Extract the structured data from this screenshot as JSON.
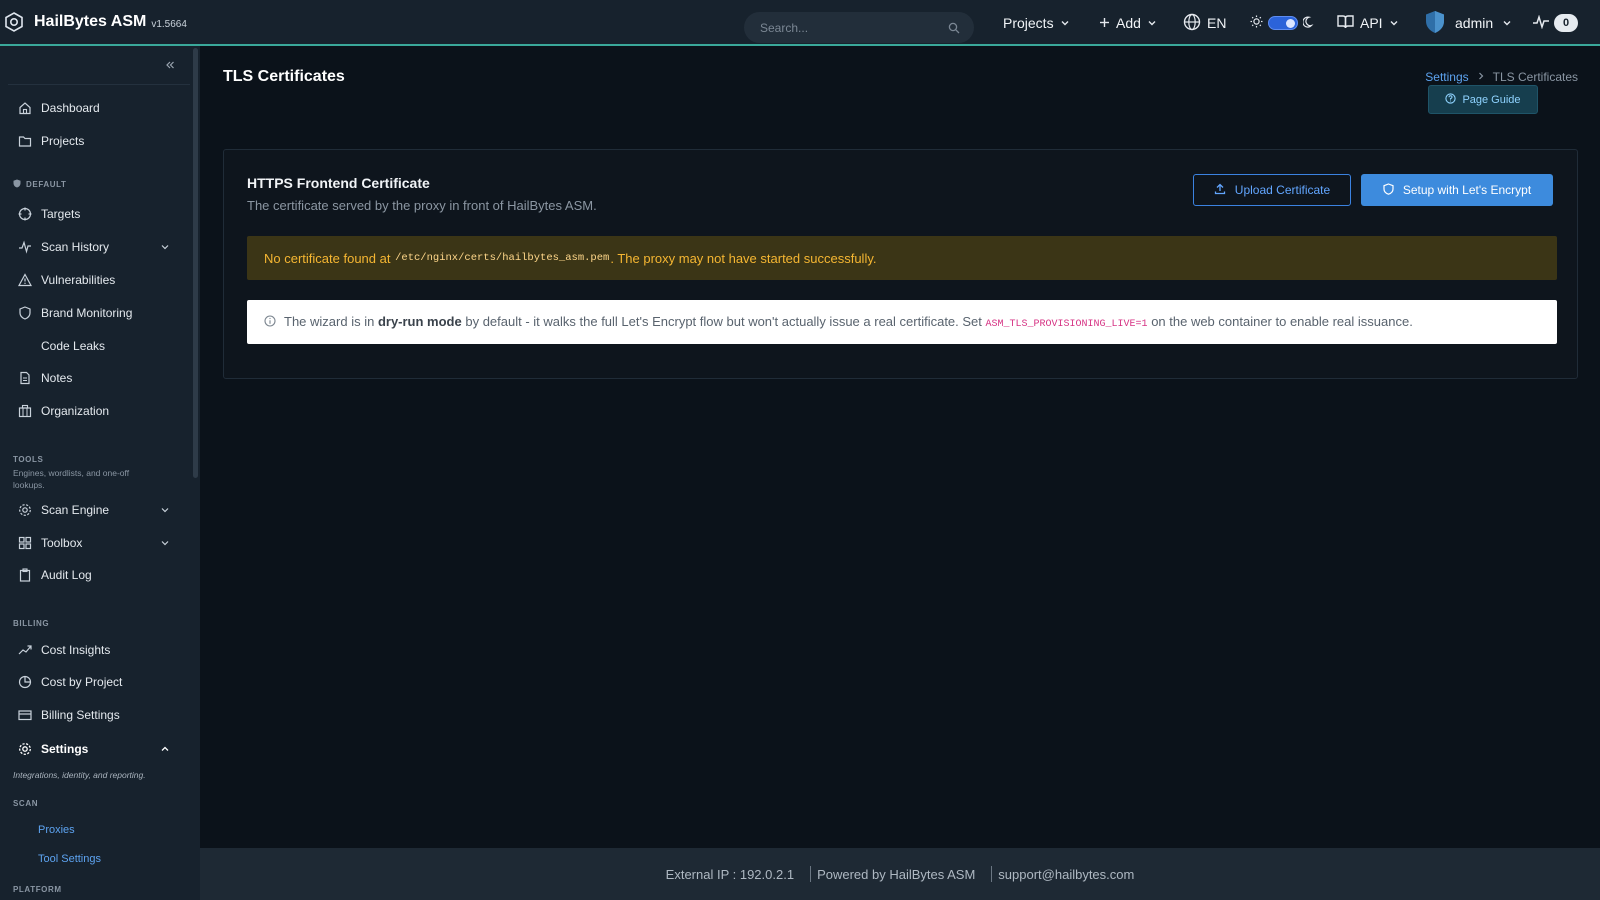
{
  "app": {
    "name": "HailBytes ASM",
    "version": "v1.5664"
  },
  "topbar": {
    "search_placeholder": "Search...",
    "projects_label": "Projects",
    "add_label": "Add",
    "language": "EN",
    "api_label": "API",
    "user": "admin",
    "activity_count": "0"
  },
  "sidebar": {
    "items": {
      "dashboard": "Dashboard",
      "projects": "Projects",
      "targets": "Targets",
      "scan_history": "Scan History",
      "vulnerabilities": "Vulnerabilities",
      "brand_monitoring": "Brand Monitoring",
      "code_leaks": "Code Leaks",
      "notes": "Notes",
      "organization": "Organization",
      "scan_engine": "Scan Engine",
      "toolbox": "Toolbox",
      "audit_log": "Audit Log",
      "cost_insights": "Cost Insights",
      "cost_by_project": "Cost by Project",
      "billing_settings": "Billing Settings",
      "settings": "Settings"
    },
    "sections": {
      "default": "DEFAULT",
      "tools": "TOOLS",
      "tools_desc": "Engines, wordlists, and one-off lookups.",
      "billing": "BILLING",
      "settings_desc": "Integrations, identity, and reporting.",
      "scan": "SCAN",
      "platform": "PLATFORM"
    },
    "sub_items": {
      "proxies": "Proxies",
      "tool_settings": "Tool Settings"
    }
  },
  "page": {
    "title": "TLS Certificates",
    "breadcrumb": {
      "parent": "Settings",
      "current": "TLS Certificates"
    },
    "guide_label": "Page Guide"
  },
  "card": {
    "title": "HTTPS Frontend Certificate",
    "subtitle": "The certificate served by the proxy in front of HailBytes ASM.",
    "upload_label": "Upload Certificate",
    "letsencrypt_label": "Setup with Let's Encrypt",
    "warning": {
      "prefix": "No certificate found at",
      "path": "/etc/nginx/certs/hailbytes_asm.pem",
      "suffix": ". The proxy may not have started successfully."
    },
    "info": {
      "prefix": "The wizard is in",
      "bold": "dry-run mode",
      "middle": "by default - it walks the full Let's Encrypt flow but won't actually issue a real certificate. Set",
      "env": "ASM_TLS_PROVISIONING_LIVE=1",
      "suffix": "on the web container to enable real issuance."
    }
  },
  "footer": {
    "external_ip": "External IP : 192.0.2.1",
    "powered_by": "Powered by HailBytes ASM",
    "support": "support@hailbytes.com"
  },
  "colors": {
    "accent_teal": "#3aa89a",
    "primary_blue": "#3d8bdd",
    "warning_text": "#f5b632",
    "warning_bg": "#3b3516"
  }
}
